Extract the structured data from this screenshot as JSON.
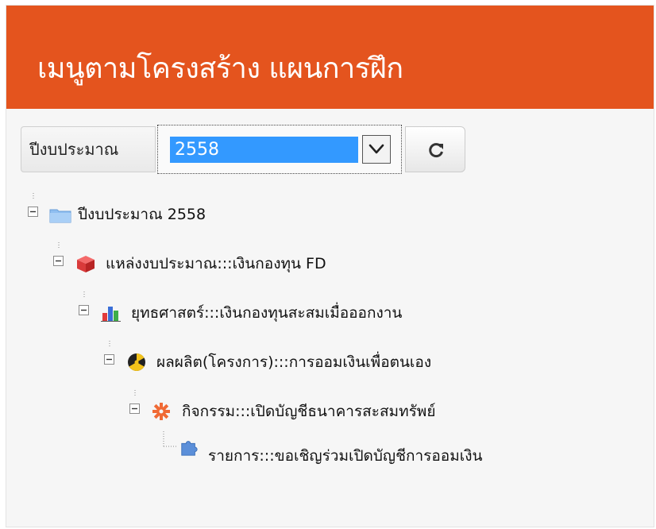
{
  "header": {
    "title": "เมนูตามโครงสร้าง แผนการฝึก"
  },
  "toolbar": {
    "year_label": "ปีงบประมาณ",
    "year_value": "2558",
    "refresh_icon": "refresh-icon",
    "dropdown_icon": "chevron-down-icon"
  },
  "tree": {
    "root": {
      "label": "ปีงบประมาณ 2558",
      "icon": "folder-icon"
    },
    "level1": {
      "label": "แหล่งงบประมาณ:::เงินกองทุน FD",
      "icon": "cube-icon"
    },
    "level2": {
      "label": "ยุทธศาสตร์:::เงินกองทุนสะสมเมื่อออกงาน",
      "icon": "bar-chart-icon"
    },
    "level3": {
      "label": "ผลผลิต(โครงการ):::การออมเงินเพื่อตนเอง",
      "icon": "radiation-icon"
    },
    "level4": {
      "label": "กิจกรรม:::เปิดบัญชีธนาคารสะสมทรัพย์",
      "icon": "gear-icon"
    },
    "level5": {
      "label": "รายการ:::ขอเชิญร่วมเปิดบัญชีการออมเงิน",
      "icon": "puzzle-icon"
    }
  },
  "colors": {
    "header": "#e4541e",
    "selection": "#3399ff",
    "panel": "#f6f6f6"
  }
}
